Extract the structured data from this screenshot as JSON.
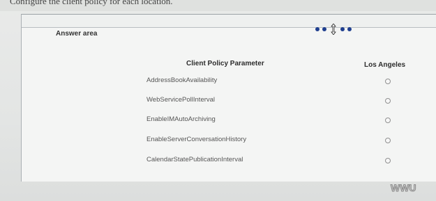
{
  "header": {
    "top_text": "Configure the client policy for each location."
  },
  "answer_area": {
    "title": "Answer area"
  },
  "table": {
    "column_parameter": "Client Policy Parameter",
    "column_location": "Los Angeles",
    "rows": [
      {
        "label": "AddressBookAvailability",
        "selected": false
      },
      {
        "label": "WebServicePollInterval",
        "selected": false
      },
      {
        "label": "EnableIMAutoArchiving",
        "selected": false
      },
      {
        "label": "EnableServerConversationHistory",
        "selected": false
      },
      {
        "label": "CalendarStatePublicationInterval",
        "selected": false
      }
    ]
  },
  "watermark": {
    "text": "WWU"
  },
  "colors": {
    "loader": "#1f3f8f",
    "background": "#e9eae9",
    "panel": "#f4f5f4"
  }
}
